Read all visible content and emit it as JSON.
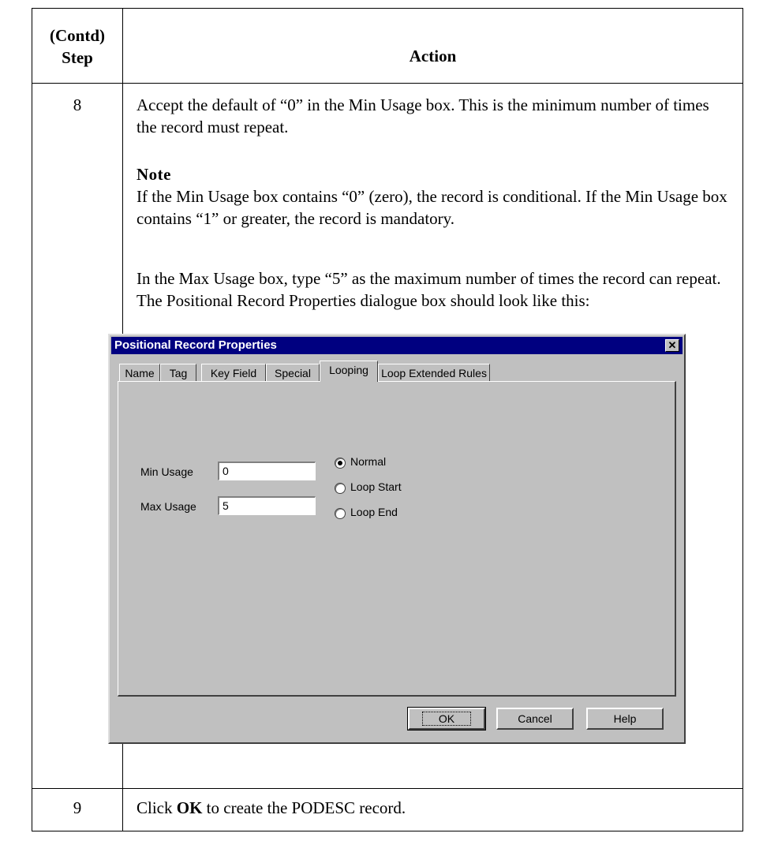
{
  "header": {
    "step_line1": "(Contd)",
    "step_line2": "Step",
    "action": "Action"
  },
  "rows": [
    {
      "step": "8",
      "para1": "Accept the default of “0” in the Min Usage box. This is the minimum number of times the record must repeat.",
      "note_title": "Note",
      "note_text": "If the Min Usage box contains “0” (zero), the record is conditional. If the Min Usage box contains “1” or greater, the record is mandatory.",
      "para2": "In the Max Usage box, type “5” as the maximum number of times the record can repeat. The Positional Record Properties dialogue box should look like this:"
    },
    {
      "step": "9",
      "text_before": "Click ",
      "text_bold": "OK",
      "text_after": " to create the PODESC record."
    }
  ],
  "dialog": {
    "title": "Positional Record Properties",
    "close_glyph": "✕",
    "tabs": [
      "Name",
      "Tag",
      "Key Field",
      "Special",
      "Looping",
      "Loop Extended Rules"
    ],
    "active_tab": "Looping",
    "min_usage_label": "Min Usage",
    "min_usage_value": "0",
    "max_usage_label": "Max Usage",
    "max_usage_value": "5",
    "radios": [
      {
        "label": "Normal",
        "selected": true
      },
      {
        "label": "Loop Start",
        "selected": false
      },
      {
        "label": "Loop End",
        "selected": false
      }
    ],
    "buttons": {
      "ok": "OK",
      "cancel": "Cancel",
      "help": "Help"
    }
  }
}
